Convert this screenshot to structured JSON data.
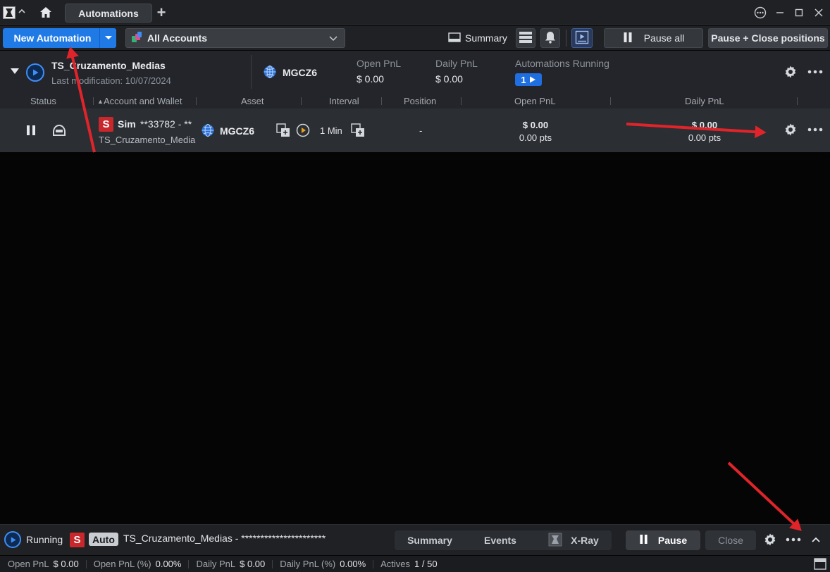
{
  "titlebar": {
    "active_tab": "Automations",
    "add_tab_glyph": "+"
  },
  "toolbar": {
    "new_automation": "New Automation",
    "account_filter": "All Accounts",
    "summary": "Summary",
    "pause_all": "Pause all",
    "pause_close": "Pause + Close positions"
  },
  "group": {
    "name": "TS_Cruzamento_Medias",
    "last_modification": "Last modification: 10/07/2024",
    "asset": "MGCZ6",
    "open_pnl_label": "Open PnL",
    "open_pnl": "$ 0.00",
    "daily_pnl_label": "Daily PnL",
    "daily_pnl": "$ 0.00",
    "running_label": "Automations Running",
    "running_count": "1"
  },
  "columns": [
    "Status",
    "Account and Wallet",
    "Asset",
    "Interval",
    "Position",
    "Open PnL",
    "Daily PnL"
  ],
  "row": {
    "badge": "S",
    "account_type": "Sim",
    "account_id": "**33782 - **",
    "wallet": "TS_Cruzamento_Media",
    "asset": "MGCZ6",
    "interval": "1 Min",
    "position": "-",
    "open_pnl": "$ 0.00",
    "open_pts": "0.00 pts",
    "daily_pnl": "$ 0.00",
    "daily_pts": "0.00 pts"
  },
  "bottom": {
    "status": "Running",
    "badge": "S",
    "auto": "Auto",
    "strategy": "TS_Cruzamento_Medias - **********************",
    "tabs": [
      "Summary",
      "Events",
      "X-Ray"
    ],
    "pause": "Pause",
    "close": "Close"
  },
  "statusbar": {
    "open_pnl_label": "Open PnL",
    "open_pnl": "$ 0.00",
    "open_pnl_pct_label": "Open PnL (%)",
    "open_pnl_pct": "0.00%",
    "daily_pnl_label": "Daily PnL",
    "daily_pnl": "$ 0.00",
    "daily_pnl_pct_label": "Daily PnL (%)",
    "daily_pnl_pct": "0.00%",
    "actives_label": "Actives",
    "actives": "1 / 50"
  },
  "colors": {
    "accent": "#1f7ae6",
    "badge_red": "#c8272b",
    "annotation_arrow": "#e0242a"
  }
}
